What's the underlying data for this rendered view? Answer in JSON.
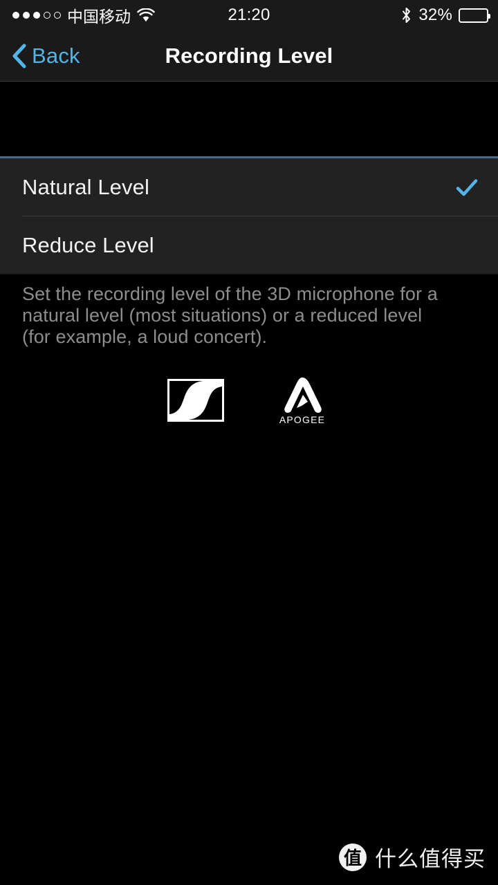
{
  "status_bar": {
    "signal_dots_filled": 3,
    "signal_dots_total": 5,
    "carrier": "中国移动",
    "wifi_icon": "wifi-icon",
    "time": "21:20",
    "bluetooth_icon": "bluetooth-icon",
    "battery_percent_label": "32%",
    "battery_fill_percent": 32
  },
  "nav_bar": {
    "back_icon": "chevron-left-icon",
    "back_label": "Back",
    "title": "Recording Level"
  },
  "list": {
    "options": [
      {
        "label": "Natural Level",
        "selected": true,
        "check_icon": "checkmark-icon"
      },
      {
        "label": "Reduce Level",
        "selected": false,
        "check_icon": ""
      }
    ]
  },
  "footer": {
    "description": "Set the recording level of the 3D microphone for a natural level (most situations) or a reduced level (for example, a loud concert)."
  },
  "logos": [
    {
      "name": "sennheiser-logo",
      "alt": "Sennheiser"
    },
    {
      "name": "apogee-logo",
      "alt": "APOGEE",
      "wordmark": "APOGEE"
    }
  ],
  "watermark": {
    "badge": "值",
    "text": "什么值得买"
  },
  "colors": {
    "accent_blue": "#52b5e8",
    "list_bg": "#222222",
    "page_bg": "#000000",
    "bar_bg": "#1a1a1a",
    "section_rule": "#4a6a8a",
    "muted_text": "#8d8d8d"
  }
}
